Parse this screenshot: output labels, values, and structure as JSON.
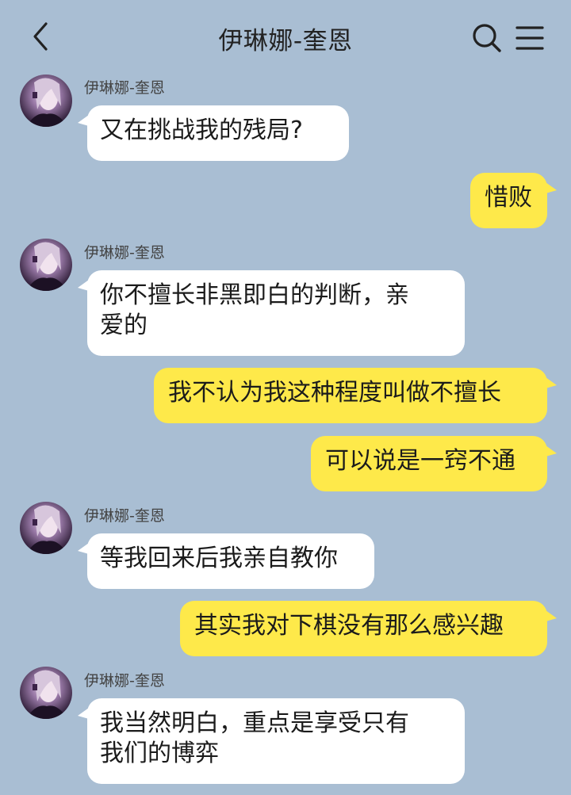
{
  "header": {
    "title": "伊琳娜-奎恩",
    "back_icon": "chevron-left-icon",
    "search_icon": "search-icon",
    "menu_icon": "menu-icon"
  },
  "contact": {
    "name": "伊琳娜-奎恩"
  },
  "messages": [
    {
      "side": "left",
      "sender": "伊琳娜-奎恩",
      "lines": [
        "又在挑战我的残局?"
      ]
    },
    {
      "side": "right",
      "lines": [
        "惜败"
      ]
    },
    {
      "side": "left",
      "sender": "伊琳娜-奎恩",
      "lines": [
        "你不擅长非黑即白的判断，亲",
        "爱的"
      ]
    },
    {
      "side": "right",
      "lines": [
        "我不认为我这种程度叫做不擅长"
      ]
    },
    {
      "side": "right",
      "lines": [
        "可以说是一窍不通"
      ]
    },
    {
      "side": "left",
      "sender": "伊琳娜-奎恩",
      "lines": [
        "等我回来后我亲自教你"
      ]
    },
    {
      "side": "right",
      "lines": [
        "其实我对下棋没有那么感兴趣"
      ]
    },
    {
      "side": "left",
      "sender": "伊琳娜-奎恩",
      "lines": [
        "我当然明白，重点是享受只有",
        "我们的博弈"
      ]
    }
  ],
  "colors": {
    "background": "#a9bed3",
    "incoming_bubble": "#ffffff",
    "outgoing_bubble": "#fee94a"
  }
}
